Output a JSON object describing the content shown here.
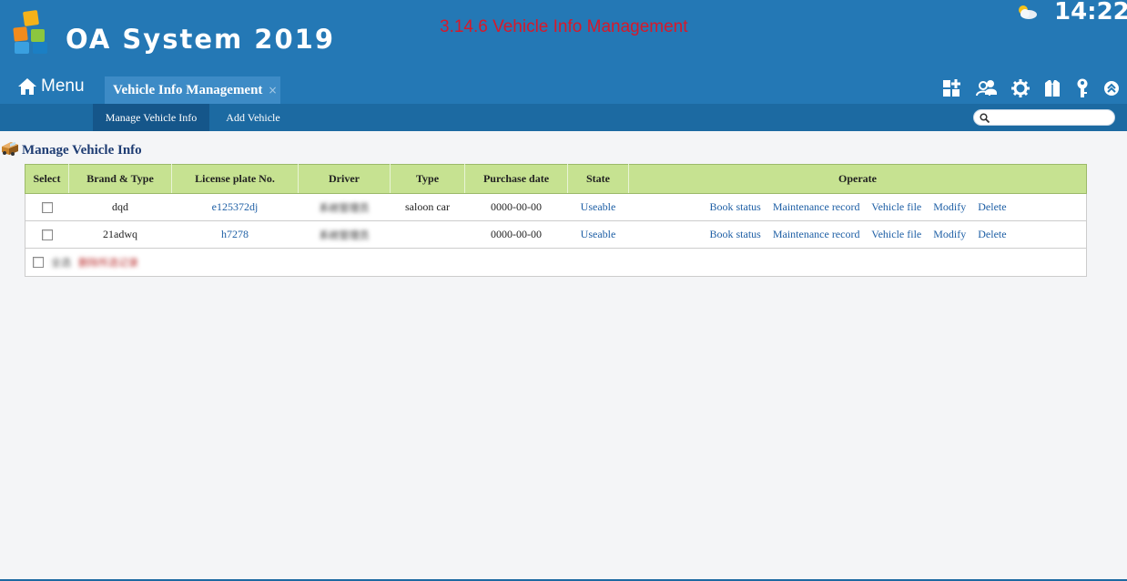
{
  "header": {
    "app_title": "OA System 2019",
    "doc_title": "3.14.6 Vehicle Info Management",
    "clock": "14:22",
    "menu_label": "Menu",
    "tab_label": "Vehicle Info Management",
    "tab_close": "×",
    "toolbar_icons": [
      "apps-add-icon",
      "users-icon",
      "settings-gear-icon",
      "shirt-icon",
      "key-icon",
      "collapse-up-icon"
    ]
  },
  "subnav": {
    "items": [
      {
        "label": "Manage Vehicle Info",
        "active": true
      },
      {
        "label": "Add Vehicle",
        "active": false
      }
    ],
    "search_placeholder": ""
  },
  "section": {
    "title": "Manage Vehicle Info"
  },
  "table": {
    "columns": [
      "Select",
      "Brand & Type",
      "License plate No.",
      "Driver",
      "Type",
      "Purchase date",
      "State",
      "Operate"
    ],
    "rows": [
      {
        "brand": "dqd",
        "plate": "e125372dj",
        "driver": "系统管理员",
        "type": "saloon car",
        "purchase_date": "0000-00-00",
        "state": "Useable",
        "ops": [
          "Book status",
          "Maintenance record",
          "Vehicle file",
          "Modify",
          "Delete"
        ]
      },
      {
        "brand": "21adwq",
        "plate": "h7278",
        "driver": "系统管理员",
        "type": "",
        "purchase_date": "0000-00-00",
        "state": "Useable",
        "ops": [
          "Book status",
          "Maintenance record",
          "Vehicle file",
          "Modify",
          "Delete"
        ]
      }
    ],
    "footer": {
      "select_all": "全选",
      "delete_selected": "删除所选记录"
    }
  },
  "colors": {
    "header_bg": "#2478b5",
    "subnav_bg": "#1c6aa2",
    "doc_title": "#d7192a",
    "table_header_bg": "#c6e291",
    "link": "#1e5fa5"
  }
}
